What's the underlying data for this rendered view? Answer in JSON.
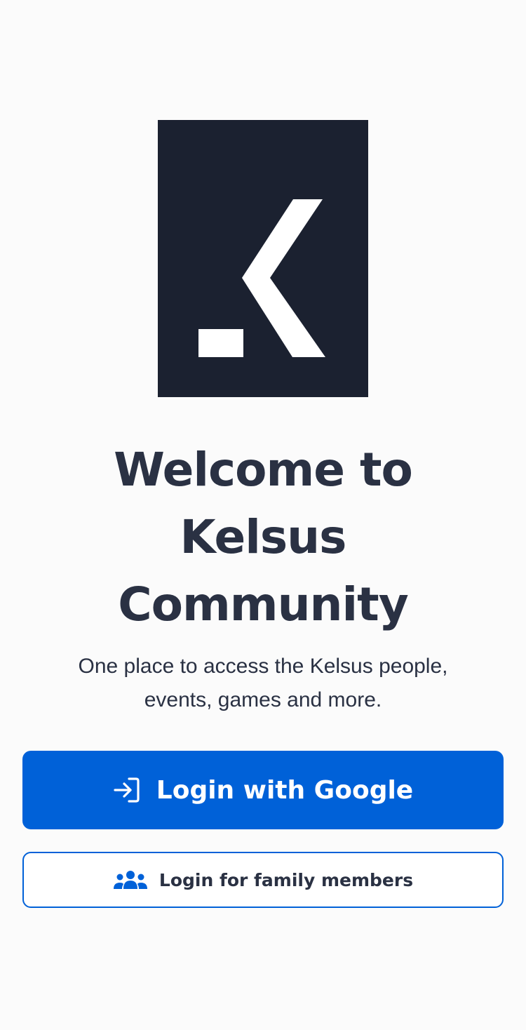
{
  "app": {
    "logo_icon": "kelsus-logo",
    "logo_bg": "#1b2130",
    "logo_fg": "#ffffff"
  },
  "hero": {
    "title_line1": "Welcome to",
    "title_line2": "Kelsus",
    "title_line3": "Community",
    "subtitle_line1": "One place to access the Kelsus people,",
    "subtitle_line2": "events, games and more."
  },
  "actions": {
    "google_login": {
      "label": "Login with Google",
      "icon": "login-arrow-icon",
      "bg_color": "#0061d8",
      "text_color": "#ffffff"
    },
    "family_login": {
      "label": "Login for family members",
      "icon": "users-group-icon",
      "border_color": "#0061d8",
      "text_color": "#2a3143"
    }
  }
}
